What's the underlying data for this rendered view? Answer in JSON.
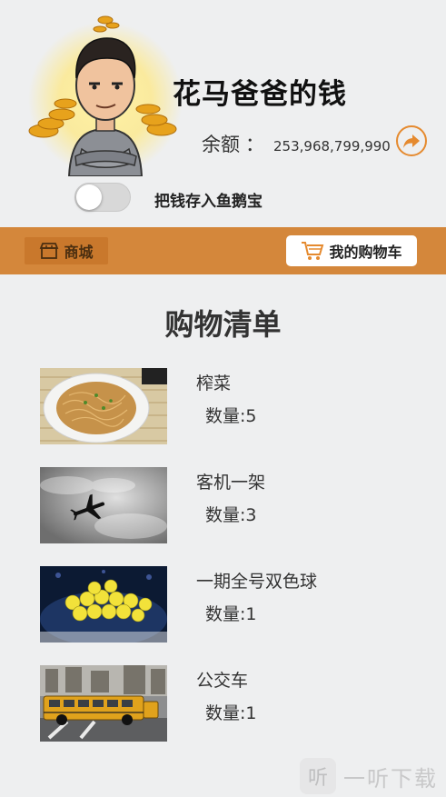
{
  "header": {
    "title": "花马爸爸的钱",
    "balance_label": "余额",
    "balance_colon": "：",
    "balance_value": "253,968,799,990"
  },
  "toggle": {
    "label": "把钱存入鱼鹅宝",
    "on": false
  },
  "navbar": {
    "shop_label": "商城",
    "cart_label": "我的购物车"
  },
  "list": {
    "title": "购物清单",
    "items": [
      {
        "name": "榨菜",
        "qty": "数量:5",
        "icon": "noodles-photo"
      },
      {
        "name": "客机一架",
        "qty": "数量:3",
        "icon": "airplane-photo"
      },
      {
        "name": "一期全号双色球",
        "qty": "数量:1",
        "icon": "lottery-balls-photo"
      },
      {
        "name": "公交车",
        "qty": "数量:1",
        "icon": "school-bus-photo"
      }
    ]
  },
  "watermark": {
    "text": "一听下载",
    "icon_glyph": "听"
  },
  "colors": {
    "accent": "#d4873b",
    "share": "#e58a2f",
    "background": "#eeeff0"
  }
}
